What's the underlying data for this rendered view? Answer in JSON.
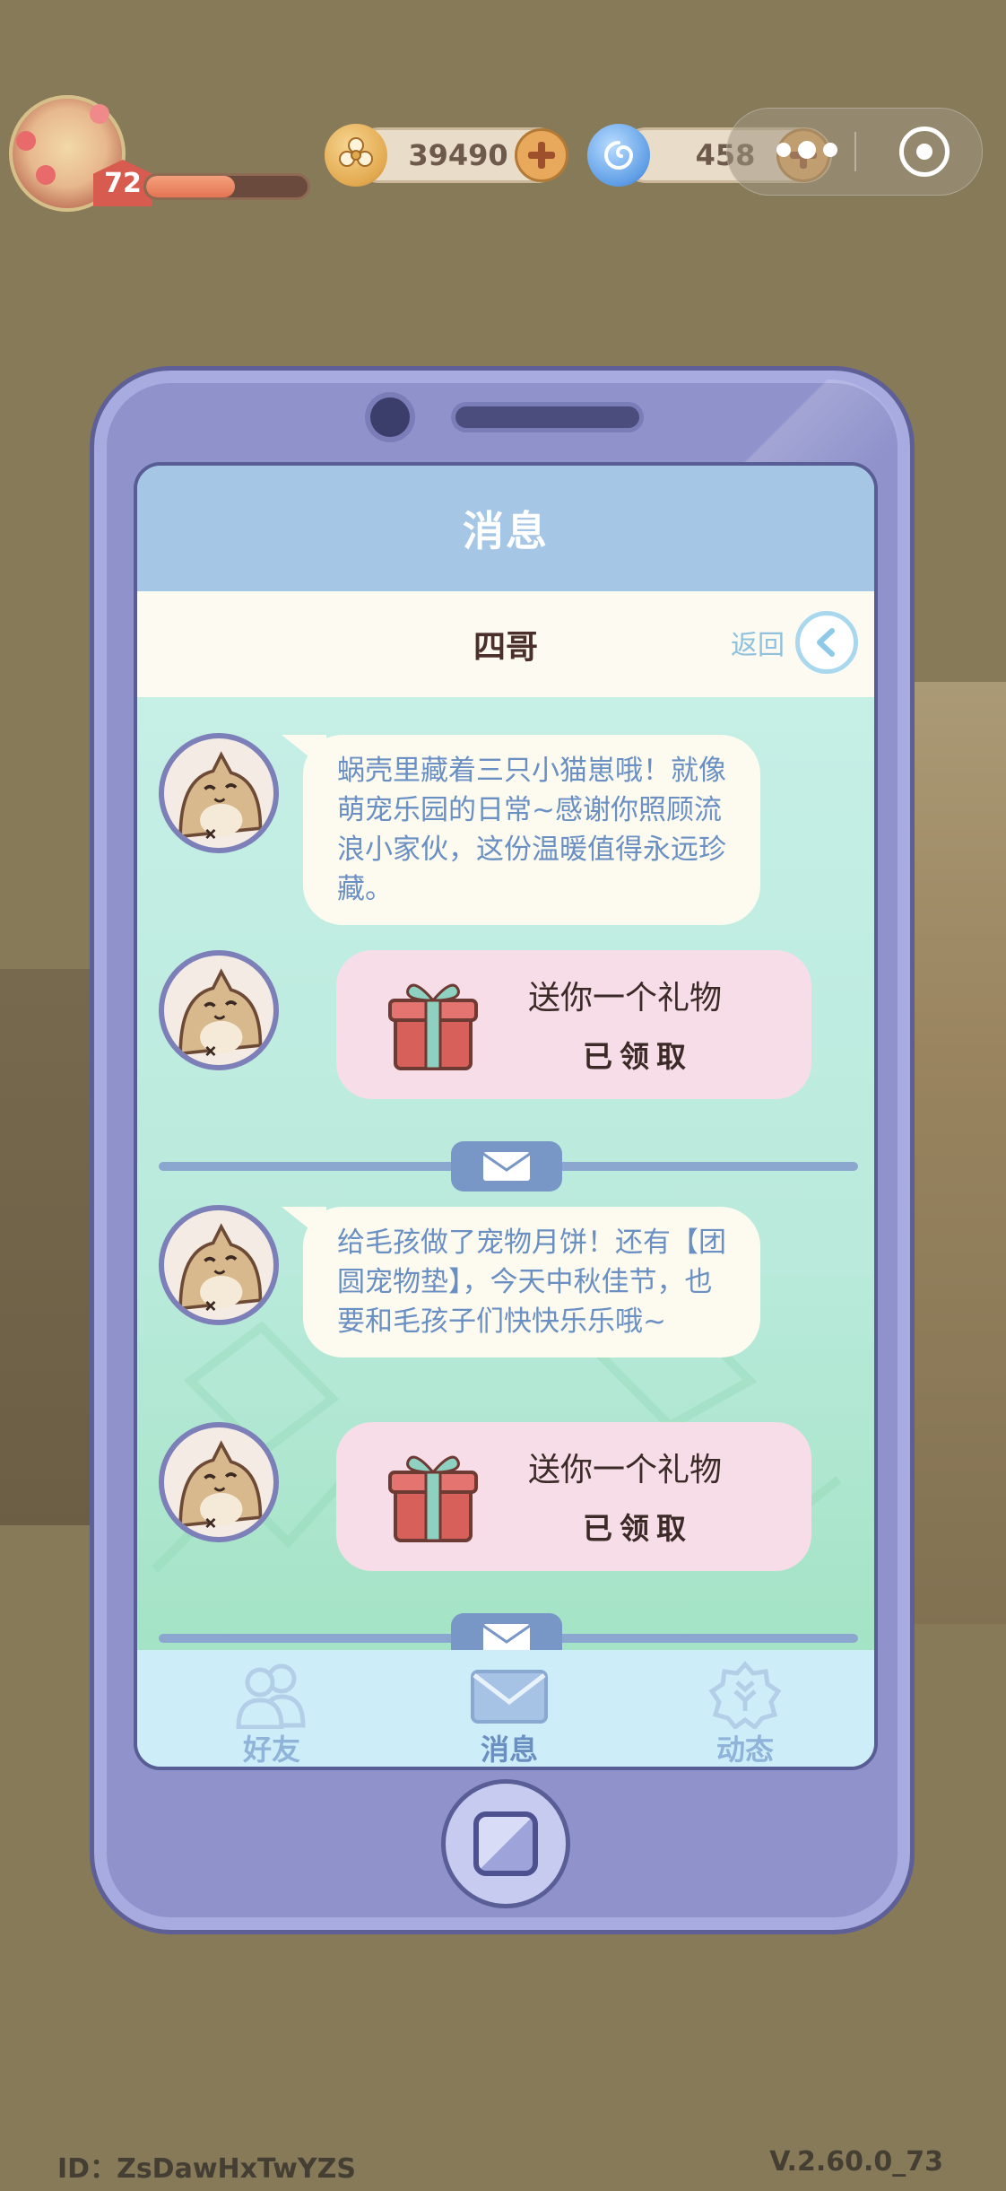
{
  "hud": {
    "level": "72",
    "xp_progress": 0.55,
    "coins": "39490",
    "gems": "458",
    "coin_icon": "flower-coin-icon",
    "gem_icon": "swirl-gem-icon"
  },
  "phone": {
    "header_title": "消息",
    "contact_name": "四哥",
    "back_label": "返回",
    "messages": [
      {
        "text": "蜗壳里藏着三只小猫崽哦！就像萌宠乐园的日常~感谢你照顾流浪小家伙，这份温暖值得永远珍藏。"
      },
      {
        "gift_title": "送你一个礼物",
        "gift_status": "已领取"
      },
      {
        "text": "给毛孩做了宠物月饼！还有【团圆宠物垫】，今天中秋佳节，也要和毛孩子们快快乐乐哦~"
      },
      {
        "gift_title": "送你一个礼物",
        "gift_status": "已领取"
      }
    ],
    "tabs": [
      {
        "label": "好友",
        "icon": "friends-icon"
      },
      {
        "label": "消息",
        "icon": "envelope-icon"
      },
      {
        "label": "动态",
        "icon": "feed-icon"
      }
    ]
  },
  "footer": {
    "id_text": "ID：ZsDawHxTwYZS",
    "version": "V.2.60.0_73"
  },
  "colors": {
    "background": "#867a59",
    "phone_body": "#8f92cb",
    "screen_header": "#a6c6e6",
    "chat_bg": "#bce9df",
    "bubble_text": "#6a8fc3",
    "gift_card": "#f6dde8"
  }
}
